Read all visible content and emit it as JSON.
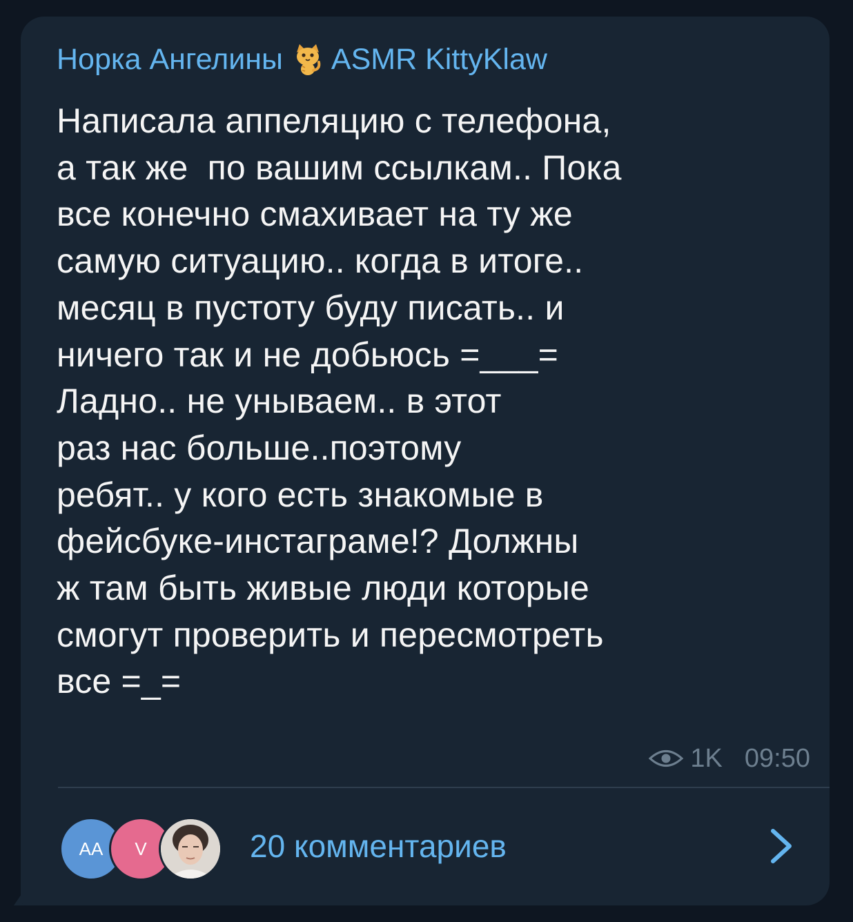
{
  "post": {
    "sender_left": "Норка Ангелины",
    "sender_emoji": "🐈",
    "sender_right": "ASMR KittyKlaw",
    "text": "Написала аппеляцию с телефона,\nа так же  по вашим ссылкам.. Пока\nвсе конечно смахивает на ту же\nсамую ситуацию.. когда в итоге..\nмесяц в пустоту буду писать.. и\nничего так и не добьюсь =___=\nЛадно.. не унываем.. в этот\nраз нас больше..поэтому\nребят.. у кого есть знакомые в\nфейсбуке-инстаграме!? Должны\nж там быть живые люди которые\nсмогут проверить и пересмотреть\nвсе =_=",
    "views": "1K",
    "time": "09:50"
  },
  "comments": {
    "label": "20 комментариев",
    "avatars": [
      {
        "initials": "AA",
        "color": "#5a95d6"
      },
      {
        "initials": "V",
        "color": "#e56a8f"
      },
      {
        "initials": "",
        "color": "#d9d4cf"
      }
    ]
  },
  "icons": {
    "cat": "cat-face-icon",
    "views": "eye-icon",
    "arrow": "chevron-right-icon"
  },
  "colors": {
    "background": "#0e1621",
    "bubble": "#182533",
    "accent": "#64b5ef",
    "text": "#f5f5f5",
    "meta": "#6d7f8f"
  }
}
